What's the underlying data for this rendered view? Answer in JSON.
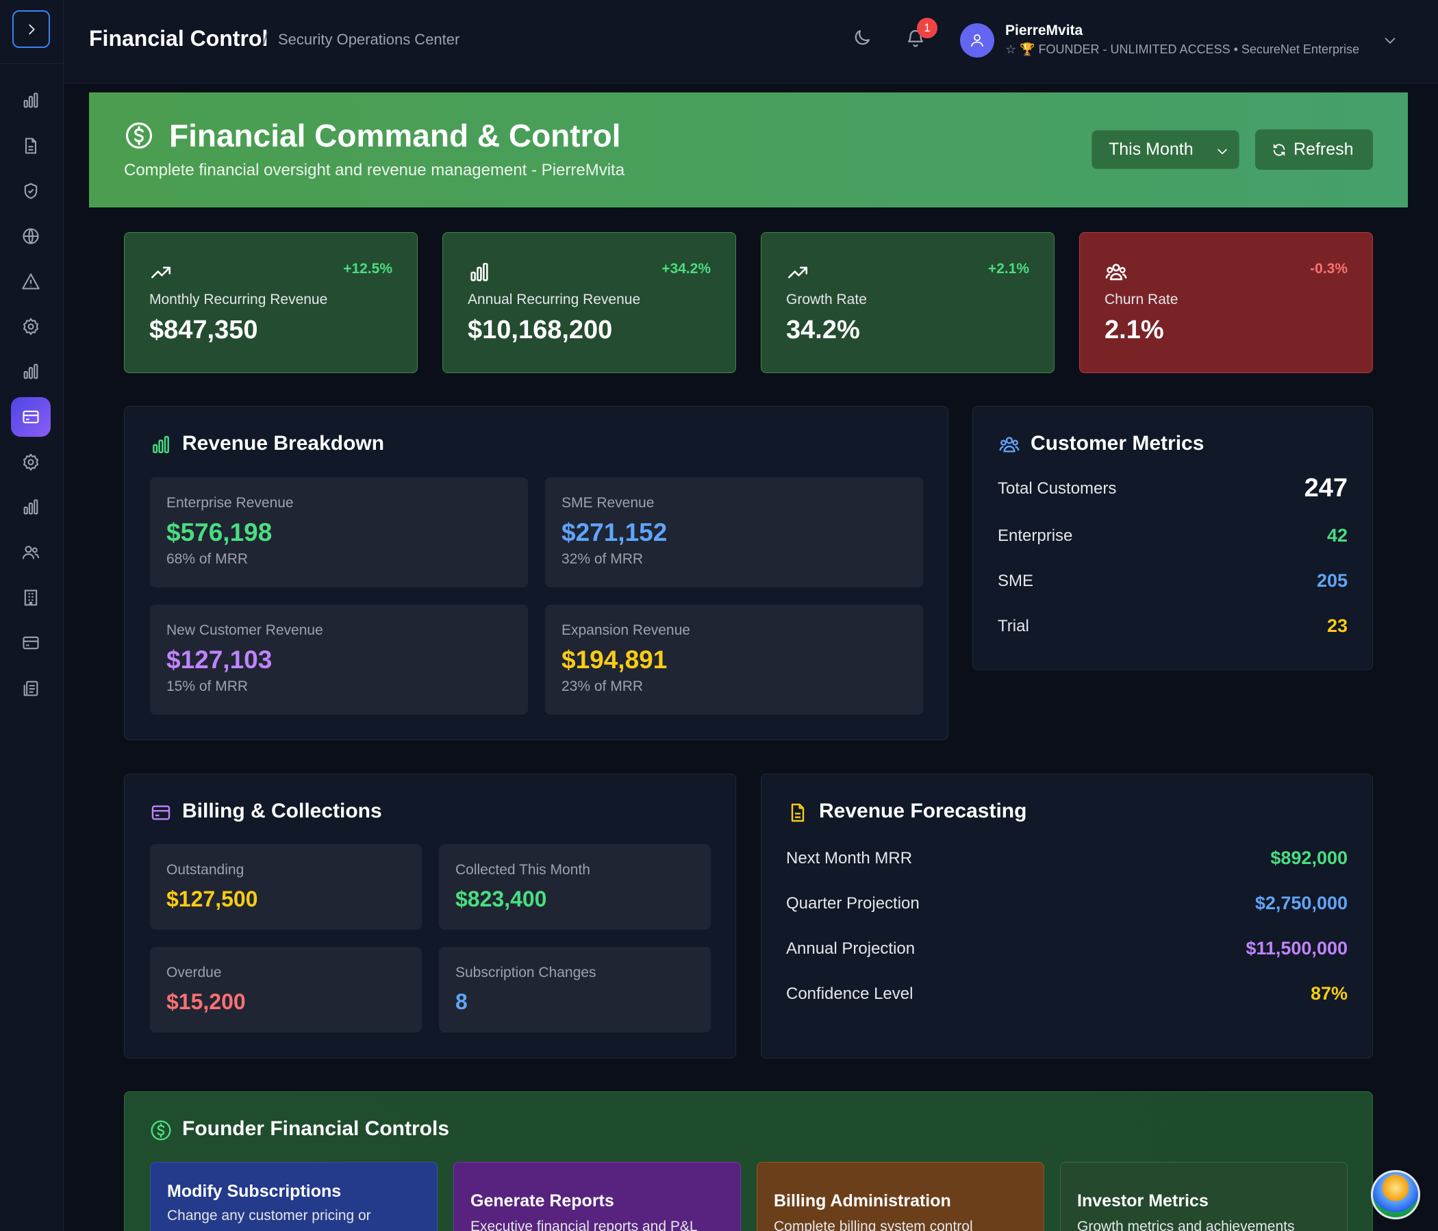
{
  "header": {
    "brand": "Financial Control",
    "separator": "/",
    "breadcrumb": "Security Operations Center",
    "notification_count": "1",
    "user_name": "PierreMvita",
    "user_role": "☆ 🏆 FOUNDER - UNLIMITED ACCESS • SecureNet Enterprise"
  },
  "sidebar": {
    "items": [
      {
        "icon": "bar-chart-icon"
      },
      {
        "icon": "document-icon"
      },
      {
        "icon": "shield-icon"
      },
      {
        "icon": "globe-icon"
      },
      {
        "icon": "alert-triangle-icon"
      },
      {
        "icon": "gear-icon"
      },
      {
        "icon": "bar-chart-icon"
      },
      {
        "icon": "credit-card-icon",
        "active": true
      },
      {
        "icon": "gear-icon"
      },
      {
        "icon": "bar-chart-icon"
      },
      {
        "icon": "users-icon"
      },
      {
        "icon": "building-icon"
      },
      {
        "icon": "credit-card-icon"
      },
      {
        "icon": "clipboard-icon"
      }
    ]
  },
  "hero": {
    "title": "Financial Command & Control",
    "subtitle": "Complete financial oversight and revenue management - PierreMvita",
    "period": "This Month",
    "refresh_label": "Refresh"
  },
  "kpis": [
    {
      "label": "Monthly Recurring Revenue",
      "value": "$847,350",
      "delta": "+12.5%"
    },
    {
      "label": "Annual Recurring Revenue",
      "value": "$10,168,200",
      "delta": "+34.2%"
    },
    {
      "label": "Growth Rate",
      "value": "34.2%",
      "delta": "+2.1%"
    },
    {
      "label": "Churn Rate",
      "value": "2.1%",
      "delta": "-0.3%"
    }
  ],
  "revenue_breakdown": {
    "title": "Revenue Breakdown",
    "tiles": [
      {
        "label": "Enterprise Revenue",
        "value": "$576,198",
        "sub": "68% of MRR"
      },
      {
        "label": "SME Revenue",
        "value": "$271,152",
        "sub": "32% of MRR"
      },
      {
        "label": "New Customer Revenue",
        "value": "$127,103",
        "sub": "15% of MRR"
      },
      {
        "label": "Expansion Revenue",
        "value": "$194,891",
        "sub": "23% of MRR"
      }
    ]
  },
  "customer_metrics": {
    "title": "Customer Metrics",
    "rows": [
      {
        "label": "Total Customers",
        "value": "247"
      },
      {
        "label": "Enterprise",
        "value": "42"
      },
      {
        "label": "SME",
        "value": "205"
      },
      {
        "label": "Trial",
        "value": "23"
      }
    ]
  },
  "billing": {
    "title": "Billing & Collections",
    "tiles": [
      {
        "label": "Outstanding",
        "value": "$127,500"
      },
      {
        "label": "Collected This Month",
        "value": "$823,400"
      },
      {
        "label": "Overdue",
        "value": "$15,200"
      },
      {
        "label": "Subscription Changes",
        "value": "8"
      }
    ]
  },
  "forecasting": {
    "title": "Revenue Forecasting",
    "rows": [
      {
        "label": "Next Month MRR",
        "value": "$892,000"
      },
      {
        "label": "Quarter Projection",
        "value": "$2,750,000"
      },
      {
        "label": "Annual Projection",
        "value": "$11,500,000"
      },
      {
        "label": "Confidence Level",
        "value": "87%"
      }
    ]
  },
  "founder_controls": {
    "title": "Founder Financial Controls",
    "cards": [
      {
        "title": "Modify Subscriptions",
        "desc": "Change any customer pricing or",
        "color": "#243a8a"
      },
      {
        "title": "Generate Reports",
        "desc": "Executive financial reports and P&L",
        "color": "#58237f"
      },
      {
        "title": "Billing Administration",
        "desc": "Complete billing system control",
        "color": "#6c3f1b"
      },
      {
        "title": "Investor Metrics",
        "desc": "Growth metrics and achievements",
        "color": "#24492c"
      }
    ]
  },
  "colors": {
    "accent": "#6366f1",
    "success": "#4ade80",
    "info": "#60a5fa",
    "purple": "#c084fc",
    "warning": "#facc15",
    "danger": "#f87171"
  }
}
